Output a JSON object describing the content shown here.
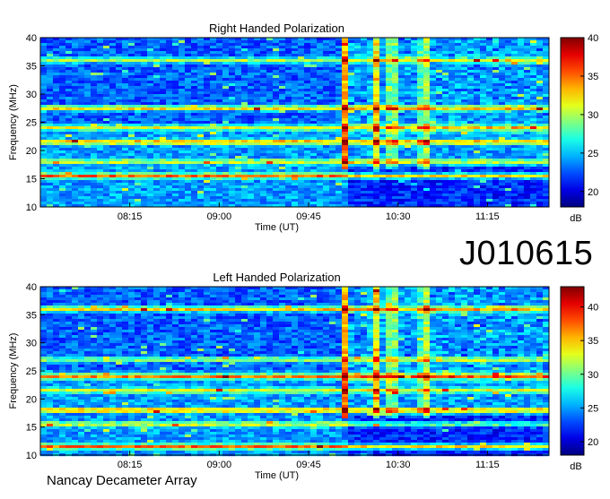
{
  "chart_data": [
    {
      "type": "heatmap",
      "title": "Right Handed Polarization",
      "xlabel": "Time (UT)",
      "ylabel": "Frequency (MHz)",
      "x_ticks": [
        "08:15",
        "09:00",
        "09:45",
        "10:30",
        "11:15"
      ],
      "x_tick_minutes": [
        495,
        540,
        585,
        630,
        675
      ],
      "xlim_minutes": [
        450,
        706
      ],
      "ylim": [
        10,
        40
      ],
      "y_ticks": [
        10,
        15,
        20,
        25,
        30,
        35,
        40
      ],
      "colorbar": {
        "label": "dB",
        "range": [
          18,
          40
        ],
        "ticks": [
          20,
          25,
          30,
          35,
          40
        ]
      },
      "features": {
        "bands_mhz": [
          15.5,
          18,
          21.5,
          24,
          27.5,
          36
        ],
        "bursts_minutes": [
          604,
          618,
          627,
          643
        ]
      }
    },
    {
      "type": "heatmap",
      "title": "Left Handed Polarization",
      "xlabel": "Time (UT)",
      "ylabel": "Frequency (MHz)",
      "x_ticks": [
        "08:15",
        "09:00",
        "09:45",
        "10:30",
        "11:15"
      ],
      "x_tick_minutes": [
        495,
        540,
        585,
        630,
        675
      ],
      "xlim_minutes": [
        450,
        706
      ],
      "ylim": [
        10,
        40
      ],
      "y_ticks": [
        10,
        15,
        20,
        25,
        30,
        35,
        40
      ],
      "colorbar": {
        "label": "dB",
        "range": [
          18,
          43
        ],
        "ticks": [
          20,
          25,
          30,
          35,
          40
        ]
      },
      "features": {
        "bands_mhz": [
          11.5,
          15.5,
          18,
          21.5,
          24,
          27,
          36
        ],
        "bursts_minutes": [
          604,
          618,
          627,
          643
        ]
      }
    }
  ],
  "figure": {
    "observation_id": "J010615",
    "instrument": "Nancay Decameter Array"
  }
}
